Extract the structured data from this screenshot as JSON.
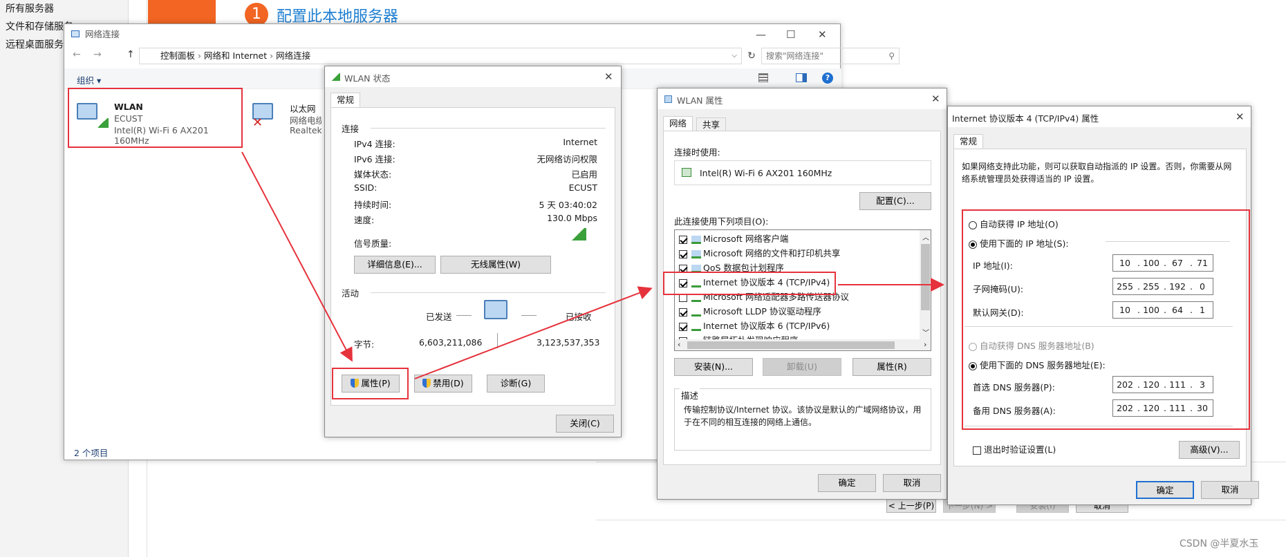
{
  "server_manager": {
    "nav_items": [
      "所有服务器",
      "文件和存储服务",
      "远程桌面服务"
    ],
    "step_number": "1",
    "step_title": "配置此本地服务器",
    "back_button": "< 上一步(P)",
    "next_button": "下一步(N) >",
    "install_button": "安装(I)",
    "cancel_button": "取消"
  },
  "network_connections": {
    "title": "网络连接",
    "breadcrumb": [
      "控制面板",
      "网络和 Internet",
      "网络连接"
    ],
    "search_placeholder": "搜索\"网络连接\"",
    "organize_label": "组织 ▾",
    "status_text": "2 个项目",
    "adapters": [
      {
        "name": "WLAN",
        "network": "ECUST",
        "device": "Intel(R) Wi-Fi 6 AX201 160MHz"
      },
      {
        "name": "以太网",
        "network": "网络电缆被拔出",
        "device": "Realtek PCIe GbE"
      }
    ]
  },
  "wlan_status": {
    "title": "WLAN 状态",
    "tab": "常规",
    "section_connection": "连接",
    "rows": [
      {
        "label": "IPv4 连接:",
        "value": "Internet"
      },
      {
        "label": "IPv6 连接:",
        "value": "无网络访问权限"
      },
      {
        "label": "媒体状态:",
        "value": "已启用"
      },
      {
        "label": "SSID:",
        "value": "ECUST"
      },
      {
        "label": "持续时间:",
        "value": "5 天 03:40:02"
      },
      {
        "label": "速度:",
        "value": "130.0 Mbps"
      }
    ],
    "signal_label": "信号质量:",
    "details_button": "详细信息(E)...",
    "wireless_props_button": "无线属性(W)",
    "section_activity": "活动",
    "sent_label": "已发送",
    "received_label": "已接收",
    "bytes_label": "字节:",
    "bytes_sent": "6,603,211,086",
    "bytes_received": "3,123,537,353",
    "properties_button": "属性(P)",
    "disable_button": "禁用(D)",
    "diagnose_button": "诊断(G)",
    "close_button": "关闭(C)"
  },
  "wlan_properties": {
    "title": "WLAN 属性",
    "tabs": [
      "网络",
      "共享"
    ],
    "connect_using_label": "连接时使用:",
    "adapter_name": "Intel(R) Wi-Fi 6 AX201 160MHz",
    "configure_button": "配置(C)...",
    "items_label": "此连接使用下列项目(O):",
    "items": [
      {
        "label": "Microsoft 网络客户端",
        "checked": true
      },
      {
        "label": "Microsoft 网络的文件和打印机共享",
        "checked": true
      },
      {
        "label": "QoS 数据包计划程序",
        "checked": true
      },
      {
        "label": "Internet 协议版本 4 (TCP/IPv4)",
        "checked": true
      },
      {
        "label": "Microsoft 网络适配器多路传送器协议",
        "checked": false
      },
      {
        "label": "Microsoft LLDP 协议驱动程序",
        "checked": true
      },
      {
        "label": "Internet 协议版本 6 (TCP/IPv6)",
        "checked": true
      },
      {
        "label": "链路层拓扑发现响应程序",
        "checked": true
      }
    ],
    "install_button": "安装(N)...",
    "uninstall_button": "卸载(U)",
    "properties_button": "属性(R)",
    "description_label": "描述",
    "description_text": "传输控制协议/Internet 协议。该协议是默认的广域网络协议，用于在不同的相互连接的网络上通信。",
    "ok_button": "确定",
    "cancel_button": "取消"
  },
  "ipv4_properties": {
    "title": "Internet 协议版本 4 (TCP/IPv4) 属性",
    "tab": "常规",
    "intro": "如果网络支持此功能，则可以获取自动指派的 IP 设置。否则，你需要从网络系统管理员处获得适当的 IP 设置。",
    "auto_ip_label": "自动获得 IP 地址(O)",
    "manual_ip_label": "使用下面的 IP 地址(S):",
    "ip_label": "IP 地址(I):",
    "ip_address": [
      "10",
      "100",
      "67",
      "71"
    ],
    "subnet_label": "子网掩码(U):",
    "subnet_mask": [
      "255",
      "255",
      "192",
      "0"
    ],
    "gateway_label": "默认网关(D):",
    "gateway": [
      "10",
      "100",
      "64",
      "1"
    ],
    "auto_dns_label": "自动获得 DNS 服务器地址(B)",
    "manual_dns_label": "使用下面的 DNS 服务器地址(E):",
    "preferred_dns_label": "首选 DNS 服务器(P):",
    "preferred_dns": [
      "202",
      "120",
      "111",
      "3"
    ],
    "alternate_dns_label": "备用 DNS 服务器(A):",
    "alternate_dns": [
      "202",
      "120",
      "111",
      "30"
    ],
    "validate_label": "退出时验证设置(L)",
    "advanced_button": "高级(V)...",
    "ok_button": "确定",
    "cancel_button": "取消"
  },
  "watermark": "CSDN @半夏水玉",
  "colors": {
    "annotation_red": "#e5323c",
    "accent_blue": "#1e7fd1",
    "orange": "#f26522"
  }
}
